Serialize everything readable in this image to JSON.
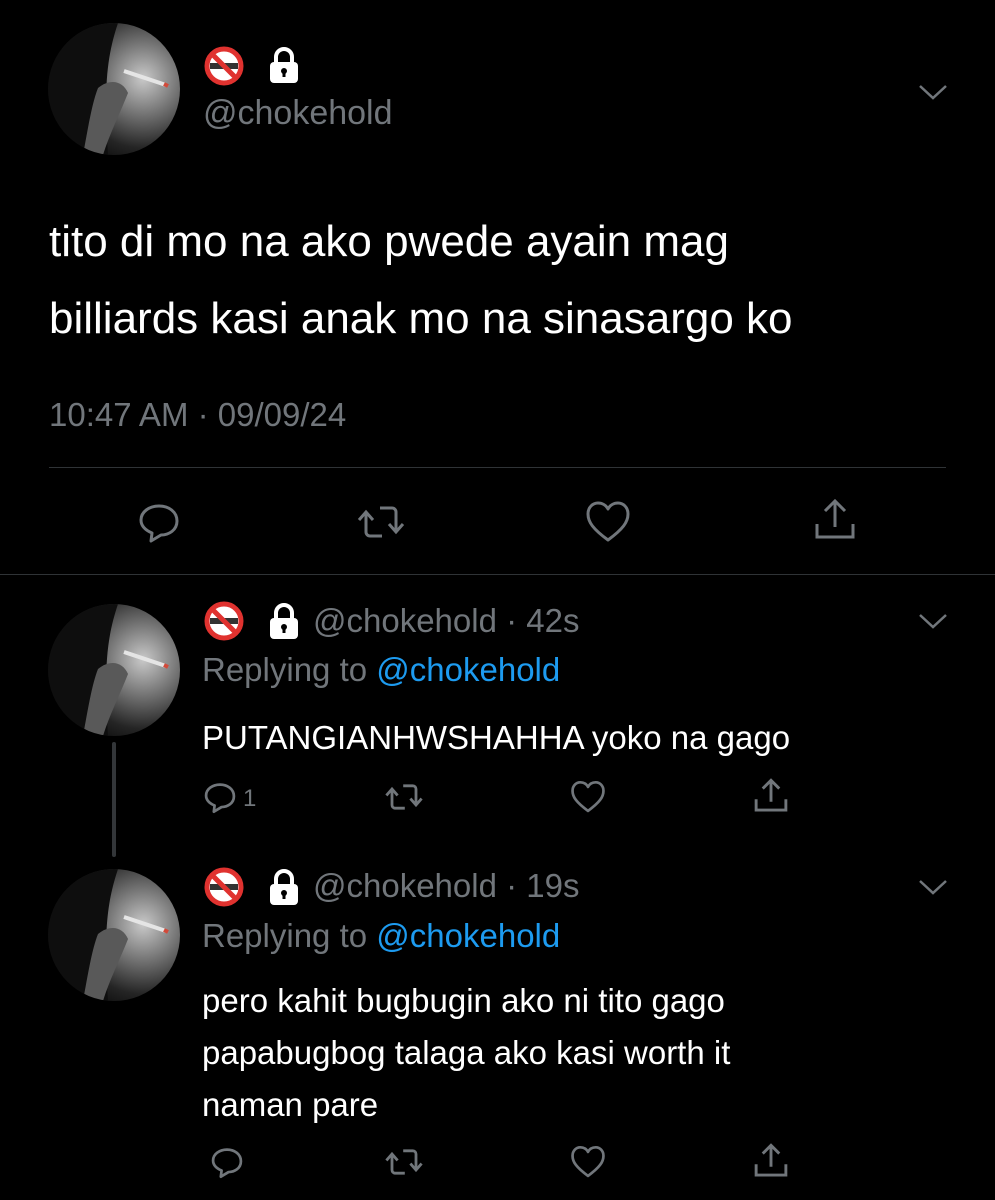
{
  "main_tweet": {
    "handle": "@chokehold",
    "text_line1": "tito di mo na ako pwede ayain mag",
    "text_line2": "billiards kasi anak mo na sinasargo ko",
    "timestamp": "10:47 AM · 09/09/24"
  },
  "replies": [
    {
      "handle": "@chokehold",
      "sep": "·",
      "time": "42s",
      "replying_prefix": "Replying to",
      "replying_to": "@chokehold",
      "text_lines": [
        "PUTANGIANHWSHAHHA yoko na gago"
      ],
      "reply_count": "1"
    },
    {
      "handle": "@chokehold",
      "sep": "·",
      "time": "19s",
      "replying_prefix": "Replying to",
      "replying_to": "@chokehold",
      "text_lines": [
        "pero kahit bugbugin ako ni tito gago",
        "papabugbog talaga ako kasi worth it",
        "naman pare"
      ],
      "reply_count": ""
    }
  ],
  "icons": {
    "no_smoking": "no-smoking-emoji",
    "lock": "lock-emoji",
    "chevron": "chevron-down-icon",
    "reply": "reply-icon",
    "retweet": "retweet-icon",
    "like": "like-icon",
    "share": "share-icon"
  },
  "colors": {
    "background": "#000000",
    "text": "#ffffff",
    "secondary": "#71767b",
    "link": "#1d9bf0",
    "divider": "#2f3336"
  }
}
